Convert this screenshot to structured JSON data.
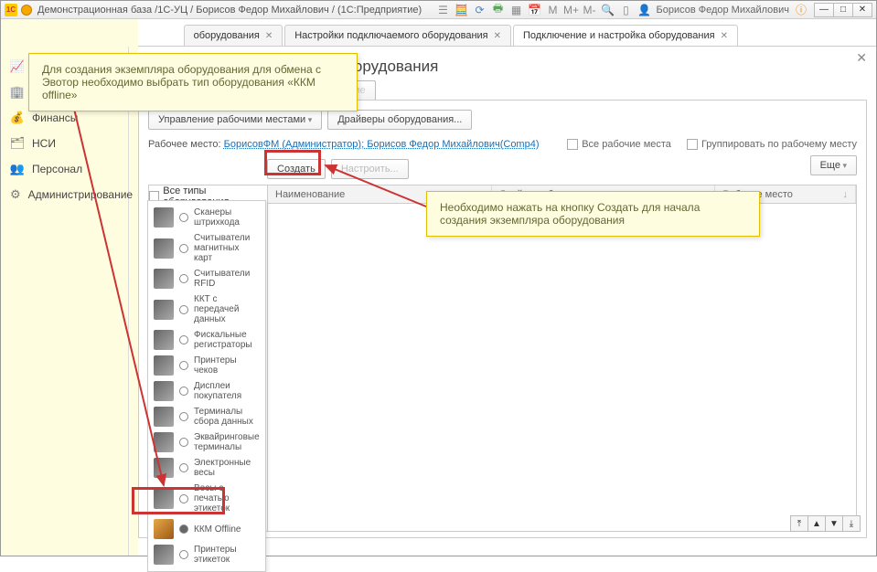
{
  "titlebar": {
    "title": "Демонстрационная база /1С-УЦ / Борисов Федор Михайлович / (1С:Предприятие)",
    "user": "Борисов Федор Михайлович"
  },
  "tabs": {
    "t1_suffix": "оборудования",
    "t2": "Настройки подключаемого оборудования",
    "t3": "Подключение и настройка оборудования"
  },
  "sidebar": {
    "items": [
      {
        "label": "Продажи"
      },
      {
        "label": "Склад"
      },
      {
        "label": "Финансы"
      },
      {
        "label": "НСИ"
      },
      {
        "label": "Персонал"
      },
      {
        "label": "Администрирование"
      }
    ]
  },
  "page": {
    "title_suffix": "стройка оборудования",
    "hidden_btn": "ое оборудование"
  },
  "panel": {
    "btn_workplaces": "Управление рабочими местами",
    "btn_drivers": "Драйверы оборудования...",
    "wp_label": "Рабочее место:",
    "wp_link": "БорисовФМ (Администратор); Борисов Федор Михайлович(Comp4)",
    "chk_all": "Все рабочие места",
    "chk_group": "Группировать по рабочему месту",
    "btn_create": "Создать",
    "btn_configure": "Настроить...",
    "btn_more": "Еще",
    "all_types": "Все типы оборудования",
    "columns": {
      "name": "Наименование",
      "driver": "Драйвер оборудования",
      "workplace": "Рабочее место"
    }
  },
  "types": [
    "Сканеры штрихкода",
    "Считыватели магнитных карт",
    "Считыватели RFID",
    "ККТ с передачей данных",
    "Фискальные регистраторы",
    "Принтеры чеков",
    "Дисплеи покупателя",
    "Терминалы сбора данных",
    "Эквайринговые терминалы",
    "Электронные весы",
    "Весы с печатью этикеток",
    "ККМ Offline",
    "Принтеры этикеток"
  ],
  "callouts": {
    "c1": "Для создания экземпляра оборудования для обмена с Эвотор необходимо выбрать тип оборудования «ККМ offline»",
    "c2": "Необходимо нажать на кнопку Создать для начала создания экземпляра оборудования"
  },
  "winbtns": {
    "info": "ⓘ",
    "min": "—",
    "max": "□",
    "close": "✕"
  },
  "m_letters": {
    "m1": "M",
    "m2": "M+",
    "m3": "M-"
  }
}
